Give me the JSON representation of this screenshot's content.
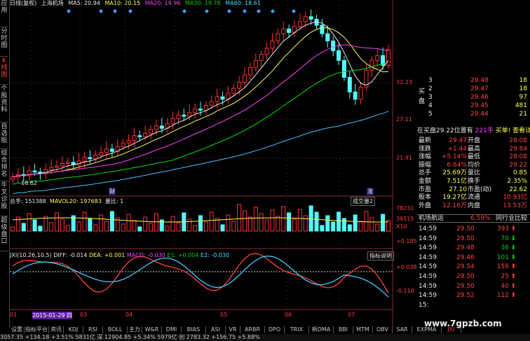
{
  "sidebar": {
    "tabs": [
      {
        "label": "应用",
        "active": false
      },
      {
        "label": "分时图",
        "active": false
      },
      {
        "label": "K线图",
        "active": true
      },
      {
        "label": "个股资料",
        "active": false
      },
      {
        "label": "自选股",
        "active": false
      },
      {
        "label": "综合排名",
        "active": false
      },
      {
        "label": "牛叉诊股",
        "active": false
      },
      {
        "label": "超级盘口",
        "active": false
      }
    ]
  },
  "topbar": {
    "period": "日线(复权)",
    "name": "上海机场",
    "ma5": "MA5: 20.94",
    "ma10": "MA10: 20.15",
    "ma20": "MA20: 19.96",
    "ma30": "MA30: 19.78",
    "ma60": "MA60: 18.61"
  },
  "price_axis": {
    "p1": "32.23",
    "p2": "27.11",
    "p3": "21.91",
    "low_label": "18.62"
  },
  "event_marks": {
    "left": "财",
    "right": "涨"
  },
  "volume": {
    "header": "总手: 151388",
    "mavol": "MAVOL20: 197683",
    "ratio": "量比: 1",
    "selector": "成交量2",
    "axis_top": "78231",
    "axis_mid": "39115",
    "axis_unit": "X10"
  },
  "indicator": {
    "header": "JXI(10,26,10,5)",
    "diff": "DIFF: -0.014",
    "dea": "DEA: +0.001",
    "macd": "MACD: -0.030",
    "e1": "E1: +0.004",
    "e2": "E2: -0.030",
    "help": "指标说明",
    "axis_top": "+0.185",
    "axis_mid": "+0.038",
    "axis_low": "-0.110"
  },
  "x_axis": [
    "01",
    "2015-01-29 四",
    "03",
    "04",
    "05",
    "06",
    "07"
  ],
  "orderbook": {
    "asks": [
      {
        "level": "3",
        "price": "29.48",
        "vol": "18"
      },
      {
        "level": "2",
        "price": "29.47",
        "vol": "18"
      },
      {
        "level": "3",
        "price": "29.46",
        "vol": "97"
      },
      {
        "level": "4",
        "price": "29.45",
        "vol": "481"
      },
      {
        "level": "5",
        "price": "29.44",
        "vol": "21"
      }
    ],
    "side_label": "买盘",
    "note": "在买盘29.22位置有",
    "note_vol": "221手",
    "note_link": "买单! 查看详细"
  },
  "quote": [
    {
      "l1": "最新",
      "v1": "29.47",
      "l2": "开盘",
      "v2": "28.08"
    },
    {
      "l1": "涨跌",
      "v1": "+1.44",
      "l2": "最高",
      "v2": "29.84"
    },
    {
      "l1": "涨幅",
      "v1": "+5.14%",
      "l2": "最低",
      "v2": "28.08"
    },
    {
      "l1": "振幅",
      "v1": "6.64%",
      "l2": "均价",
      "v2": "29.22"
    },
    {
      "l1": "总手",
      "v1": "25.69万",
      "l2": "量比",
      "v2": "0.85"
    },
    {
      "l1": "金额",
      "v1": "7.51亿",
      "l2": "换手",
      "v2": "2.35%"
    },
    {
      "l1": "市盈",
      "v1": "27.10",
      "l2": "市盈(动)",
      "v2": "22.62"
    },
    {
      "l1": "股本",
      "v1": "19.27亿",
      "l2": "流通",
      "v2": "10.93亿"
    },
    {
      "l1": "外盘",
      "v1": "12.16万",
      "l2": "内盘",
      "v2": "13.53万"
    }
  ],
  "sector": {
    "name": "机场航运",
    "pct": "6.59%",
    "compare": "同行业比较"
  },
  "ticks": [
    {
      "time": "14:59",
      "price": "29.50",
      "vol": "393",
      "dir": "up"
    },
    {
      "time": "14:59",
      "price": "29.50",
      "vol": "70",
      "dir": "down"
    },
    {
      "time": "14:59",
      "price": "29.48",
      "vol": "36",
      "dir": "down"
    },
    {
      "time": "14:59",
      "price": "29.46",
      "vol": "101",
      "dir": "down"
    },
    {
      "time": "14:59",
      "price": "29.54",
      "vol": "156",
      "dir": "up"
    },
    {
      "time": "14:59",
      "price": "29.50",
      "vol": "25",
      "dir": "up"
    },
    {
      "time": "14:59",
      "price": "29.50",
      "vol": "40",
      "dir": "up"
    },
    {
      "time": "14:59",
      "price": "29.52",
      "vol": "112",
      "dir": "up"
    },
    {
      "time": "15:",
      "price": "",
      "vol": "",
      "dir": ""
    }
  ],
  "tabs": [
    "设置",
    "指标平台",
    "资讯",
    "KDJ",
    "RSI",
    "BOLL",
    "主力",
    "W&R",
    "DMI",
    "BIAS",
    "ASI",
    "VR",
    "ARBR",
    "DPO",
    "TRIX",
    "新DMA",
    "BBI",
    "MTM",
    "OBV",
    "SAR",
    "EXPMA",
    "JXI"
  ],
  "active_tab": "JXI",
  "watermark": "www.7gpzb.com",
  "statusbar": "3057.35   +134.18   +3.51%        5831亿 深  12904.85     +5.34%         5979亿 创   2783.32   +156.75   +5.88%",
  "chart_data": {
    "type": "candlestick",
    "ylim": [
      18.0,
      33.0
    ],
    "close": [
      19.0,
      19.2,
      19.1,
      19.5,
      19.4,
      19.3,
      19.6,
      19.8,
      19.9,
      20.1,
      20.2,
      20.0,
      20.3,
      20.6,
      20.5,
      20.8,
      21.0,
      21.3,
      21.1,
      21.5,
      21.8,
      22.0,
      22.4,
      22.3,
      22.6,
      22.9,
      23.2,
      23.0,
      23.4,
      23.8,
      24.1,
      24.0,
      24.3,
      24.6,
      24.5,
      24.9,
      25.2,
      25.6,
      25.4,
      25.9,
      26.3,
      26.8,
      27.4,
      28.0,
      28.6,
      29.1,
      29.6,
      30.2,
      30.8,
      31.2,
      30.9,
      31.4,
      31.8,
      32.2,
      32.0,
      31.5,
      30.8,
      30.2,
      29.4,
      28.6,
      27.2,
      26.0,
      25.4,
      26.4,
      27.8,
      28.6,
      29.0,
      28.2,
      29.47
    ],
    "ma_lines": [
      "MA5",
      "MA10",
      "MA20",
      "MA30",
      "MA60"
    ],
    "volume_axis": [
      0,
      78231
    ]
  }
}
